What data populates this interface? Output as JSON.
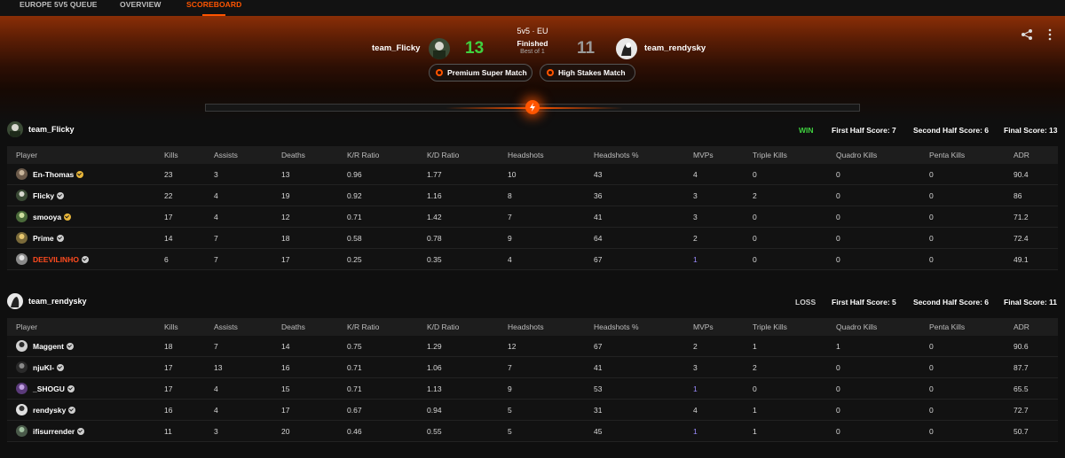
{
  "nav": {
    "tabs": [
      {
        "label": "EUROPE 5V5 QUEUE",
        "active": false
      },
      {
        "label": "OVERVIEW",
        "active": false
      },
      {
        "label": "SCOREBOARD",
        "active": true
      }
    ]
  },
  "match": {
    "mode": "5v5 · EU",
    "status": "Finished",
    "best_of": "Best of 1",
    "team1": {
      "name": "team_Flicky",
      "score": "13",
      "score_color": "#3fd13f"
    },
    "team2": {
      "name": "team_rendysky",
      "score": "11",
      "score_color": "#9a9a9a"
    },
    "badges": [
      "Premium Super Match",
      "High Stakes Match"
    ]
  },
  "columns": [
    "Player",
    "Kills",
    "Assists",
    "Deaths",
    "K/R Ratio",
    "K/D Ratio",
    "Headshots",
    "Headshots %",
    "MVPs",
    "Triple Kills",
    "Quadro Kills",
    "Penta Kills",
    "ADR"
  ],
  "teams": [
    {
      "name": "team_Flicky",
      "result": "WIN",
      "result_color": "#3fd13f",
      "first_half": "First Half Score: 7",
      "second_half": "Second Half Score: 6",
      "final": "Final Score: 13",
      "players": [
        {
          "name": "En-Thomas",
          "badge": "gold",
          "cells": [
            "23",
            "3",
            "13",
            "0.96",
            "1.77",
            "10",
            "43",
            "4",
            "0",
            "0",
            "0",
            "90.4"
          ]
        },
        {
          "name": "Flicky",
          "badge": "gray",
          "cells": [
            "22",
            "4",
            "19",
            "0.92",
            "1.16",
            "8",
            "36",
            "3",
            "2",
            "0",
            "0",
            "86"
          ]
        },
        {
          "name": "smooya",
          "badge": "gold",
          "cells": [
            "17",
            "4",
            "12",
            "0.71",
            "1.42",
            "7",
            "41",
            "3",
            "0",
            "0",
            "0",
            "71.2"
          ]
        },
        {
          "name": "Prime",
          "badge": "gray",
          "cells": [
            "14",
            "7",
            "18",
            "0.58",
            "0.78",
            "9",
            "64",
            "2",
            "0",
            "0",
            "0",
            "72.4"
          ]
        },
        {
          "name": "DEEVILINHO",
          "badge": "gray",
          "highlight": true,
          "cells": [
            "6",
            "7",
            "17",
            "0.25",
            "0.35",
            "4",
            "67",
            "1",
            "0",
            "0",
            "0",
            "49.1"
          ]
        }
      ]
    },
    {
      "name": "team_rendysky",
      "result": "LOSS",
      "result_color": "#cfcfcf",
      "first_half": "First Half Score: 5",
      "second_half": "Second Half Score: 6",
      "final": "Final Score: 11",
      "players": [
        {
          "name": "Maggent",
          "badge": "gray",
          "cells": [
            "18",
            "7",
            "14",
            "0.75",
            "1.29",
            "12",
            "67",
            "2",
            "1",
            "1",
            "0",
            "90.6"
          ]
        },
        {
          "name": "njuKI-",
          "badge": "gray",
          "cells": [
            "17",
            "13",
            "16",
            "0.71",
            "1.06",
            "7",
            "41",
            "3",
            "2",
            "0",
            "0",
            "87.7"
          ]
        },
        {
          "name": "_SHOGU",
          "badge": "gray",
          "cells": [
            "17",
            "4",
            "15",
            "0.71",
            "1.13",
            "9",
            "53",
            "1",
            "0",
            "0",
            "0",
            "65.5"
          ]
        },
        {
          "name": "rendysky",
          "badge": "gray",
          "cells": [
            "16",
            "4",
            "17",
            "0.67",
            "0.94",
            "5",
            "31",
            "4",
            "1",
            "0",
            "0",
            "72.7"
          ]
        },
        {
          "name": "ifisurrender",
          "badge": "gray",
          "cells": [
            "11",
            "3",
            "20",
            "0.46",
            "0.55",
            "5",
            "45",
            "1",
            "1",
            "0",
            "0",
            "50.7"
          ]
        }
      ]
    }
  ],
  "colors": {
    "accent": "#ff5500",
    "win": "#3fd13f",
    "mvp_low": "#9b8cff"
  }
}
